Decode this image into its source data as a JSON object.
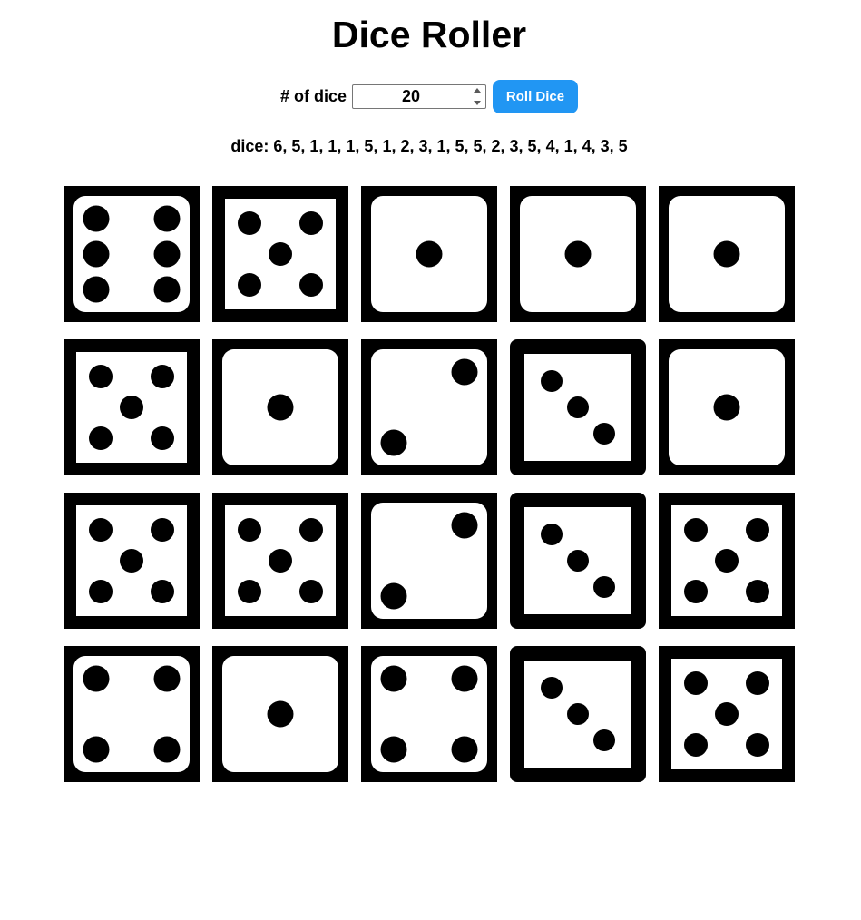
{
  "title": "Dice Roller",
  "controls": {
    "count_label": "# of dice",
    "count_value": "20",
    "roll_label": "Roll Dice"
  },
  "result": {
    "text": "dice: 6, 5, 1, 1, 1, 5, 1, 2, 3, 1, 5, 5, 2, 3, 5, 4, 1, 4, 3, 5"
  },
  "dice": [
    {
      "value": 6,
      "style": "rounded-inner"
    },
    {
      "value": 5,
      "style": "square-thick"
    },
    {
      "value": 1,
      "style": "rounded-inner"
    },
    {
      "value": 1,
      "style": "rounded-inner"
    },
    {
      "value": 1,
      "style": "rounded-inner"
    },
    {
      "value": 5,
      "style": "square-thick"
    },
    {
      "value": 1,
      "style": "rounded-inner"
    },
    {
      "value": 2,
      "style": "rounded-inner"
    },
    {
      "value": 3,
      "style": "rounded-outer"
    },
    {
      "value": 1,
      "style": "rounded-inner"
    },
    {
      "value": 5,
      "style": "square-thick"
    },
    {
      "value": 5,
      "style": "square-thick"
    },
    {
      "value": 2,
      "style": "rounded-inner"
    },
    {
      "value": 3,
      "style": "rounded-outer"
    },
    {
      "value": 5,
      "style": "square-thick"
    },
    {
      "value": 4,
      "style": "rounded-inner"
    },
    {
      "value": 1,
      "style": "rounded-inner"
    },
    {
      "value": 4,
      "style": "rounded-inner"
    },
    {
      "value": 3,
      "style": "rounded-outer"
    },
    {
      "value": 5,
      "style": "square-thick"
    }
  ],
  "colors": {
    "die_face": "#000000",
    "die_pip_area": "#ffffff",
    "button": "#2196f3",
    "button_text": "#ffffff"
  }
}
